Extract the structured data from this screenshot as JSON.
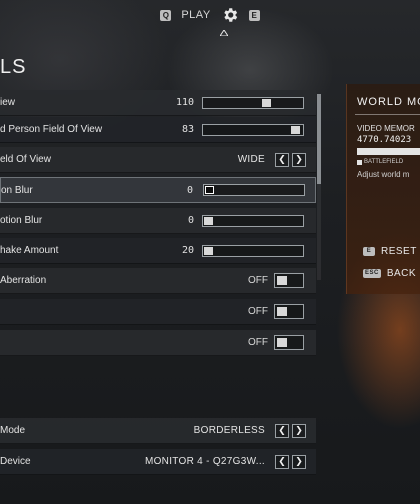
{
  "topbar": {
    "left_key": "Q",
    "play_label": "PLAY",
    "right_key": "E"
  },
  "page": {
    "title": "LS"
  },
  "settings": [
    {
      "label": "iew",
      "value": "110",
      "type": "slider",
      "level": 0.62
    },
    {
      "label": "d Person Field Of View",
      "value": "83",
      "type": "slider",
      "level": 0.92
    },
    {
      "label": "eld Of View",
      "value": "WIDE",
      "type": "stepper"
    },
    {
      "label": "on Blur",
      "value": "0",
      "type": "slider",
      "level": 0.0,
      "focused": true
    },
    {
      "label": "otion Blur",
      "value": "0",
      "type": "slider",
      "level": 0.0
    },
    {
      "label": "hake Amount",
      "value": "20",
      "type": "slider",
      "level": 0.0
    },
    {
      "label": "Aberration",
      "value": "OFF",
      "type": "toggle"
    },
    {
      "label": "",
      "value": "OFF",
      "type": "toggle"
    },
    {
      "label": "",
      "value": "OFF",
      "type": "toggle"
    }
  ],
  "section2": [
    {
      "label": "Mode",
      "value": "BORDERLESS",
      "type": "stepper"
    },
    {
      "label": "Device",
      "value": "MONITOR 4 - Q27G3W...",
      "type": "stepper"
    }
  ],
  "info": {
    "title": "WORLD MO",
    "vm_label": "VIDEO MEMOR",
    "vm_value": "4770.74023",
    "legend": "BATTLEFIELD",
    "desc": "Adjust world m"
  },
  "actions": {
    "reset_key": "E",
    "reset_label": "RESET",
    "back_key": "ESC",
    "back_label": "BACK"
  },
  "icons": {
    "gear": "gear-icon",
    "left": "chevron-left-icon",
    "right": "chevron-right-icon"
  }
}
